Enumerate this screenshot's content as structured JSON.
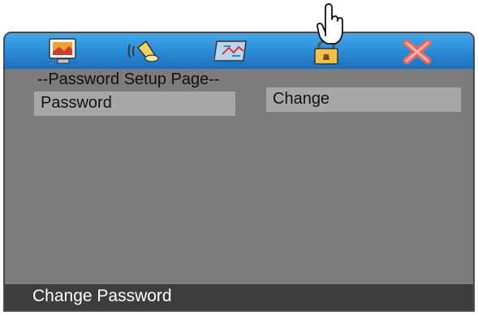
{
  "page_title": "--Password Setup Page--",
  "password_label": "Password",
  "change_option": "Change",
  "status_text": "Change Password",
  "icons": [
    "general-setup-icon",
    "audio-setup-icon",
    "video-setup-icon",
    "password-setup-icon",
    "exit-icon"
  ],
  "colors": {
    "icon_bar": "#2a88d4",
    "panel": "#7c7c7c",
    "field": "#a7a7a7",
    "status_bar": "#3d3d3d"
  }
}
